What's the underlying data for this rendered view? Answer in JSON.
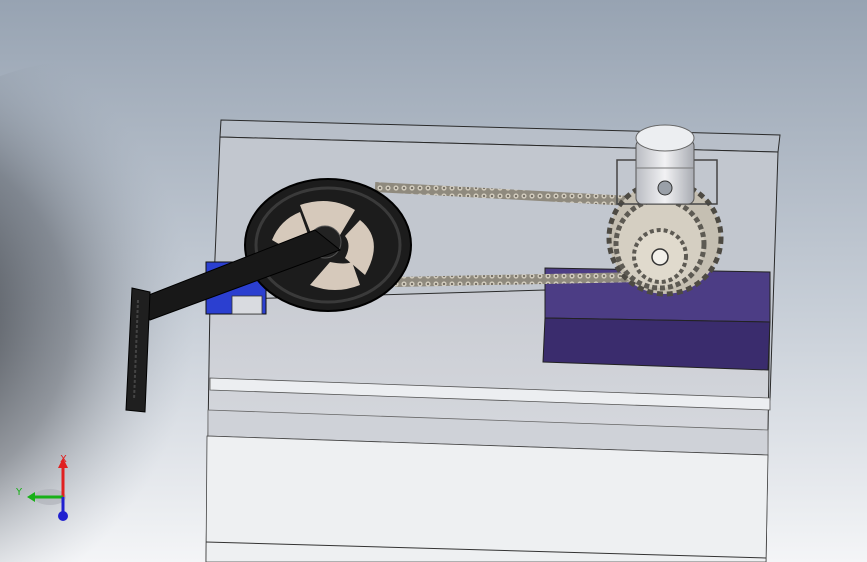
{
  "viewport": {
    "background_top": "#9aa6b4",
    "background_bottom": "#ffffff"
  },
  "model": {
    "parts": [
      "enclosure",
      "crank-arm",
      "pedal",
      "chainring",
      "chain",
      "sprocket-cluster",
      "motor",
      "motor-mount-plate",
      "crank-bracket"
    ],
    "colors": {
      "enclosure_face": "#d7d9de",
      "chainring": "#1c1c1c",
      "chainring_window": "#d6c9bb",
      "chain": "#a8a294",
      "motor": "#e6e6e8",
      "mount_plate": "#3e2f6e",
      "bracket": "#2b3fd0"
    }
  },
  "triad": {
    "x_label": "X",
    "y_label": "Y",
    "x_color": "#e02020",
    "y_color": "#18b018",
    "z_color": "#2020d0"
  }
}
